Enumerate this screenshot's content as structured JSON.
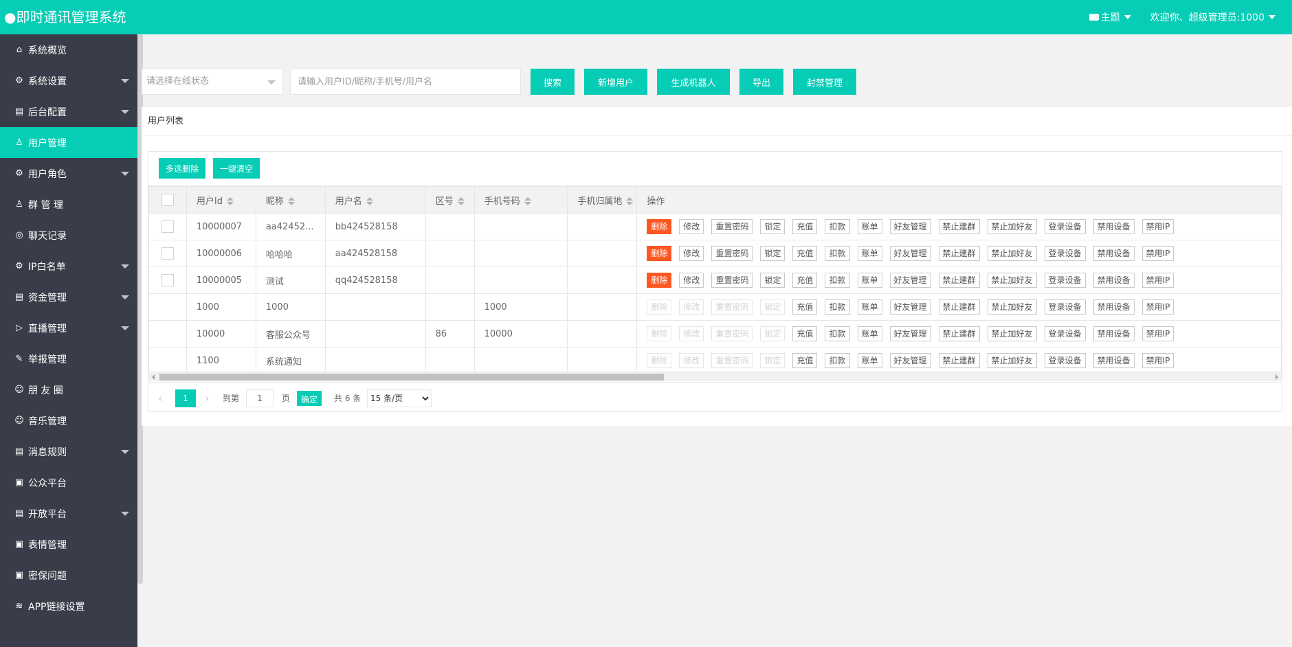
{
  "header": {
    "title": "●即时通讯管理系统",
    "theme_label": "主题",
    "welcome": "欢迎你、超级管理员:1000"
  },
  "sidebar": {
    "items": [
      {
        "label": "系统概览",
        "icon": "home-icon",
        "glyph": "⌂",
        "expandable": false,
        "active": false
      },
      {
        "label": "系统设置",
        "icon": "gear-icon",
        "glyph": "⚙",
        "expandable": true,
        "active": false
      },
      {
        "label": "后台配置",
        "icon": "calendar-icon",
        "glyph": "▤",
        "expandable": true,
        "active": false
      },
      {
        "label": "用户管理",
        "icon": "user-icon",
        "glyph": "♙",
        "expandable": false,
        "active": true
      },
      {
        "label": "用户角色",
        "icon": "gear-icon",
        "glyph": "⚙",
        "expandable": true,
        "active": false
      },
      {
        "label": "群 管 理",
        "icon": "users-icon",
        "glyph": "♙",
        "expandable": false,
        "active": false
      },
      {
        "label": "聊天记录",
        "icon": "chat-icon",
        "glyph": "◎",
        "expandable": false,
        "active": false
      },
      {
        "label": "IP白名单",
        "icon": "gear-icon",
        "glyph": "⚙",
        "expandable": true,
        "active": false
      },
      {
        "label": "资金管理",
        "icon": "calendar-icon",
        "glyph": "▤",
        "expandable": true,
        "active": false
      },
      {
        "label": "直播管理",
        "icon": "play-icon",
        "glyph": "▷",
        "expandable": true,
        "active": false
      },
      {
        "label": "举报管理",
        "icon": "edit-icon",
        "glyph": "✎",
        "expandable": false,
        "active": false
      },
      {
        "label": "朋 友 圈",
        "icon": "smile-icon",
        "glyph": "☺",
        "expandable": false,
        "active": false
      },
      {
        "label": "音乐管理",
        "icon": "smile-icon",
        "glyph": "☺",
        "expandable": false,
        "active": false
      },
      {
        "label": "消息规则",
        "icon": "calendar-icon",
        "glyph": "▤",
        "expandable": true,
        "active": false
      },
      {
        "label": "公众平台",
        "icon": "image-icon",
        "glyph": "▣",
        "expandable": false,
        "active": false
      },
      {
        "label": "开放平台",
        "icon": "calendar-icon",
        "glyph": "▤",
        "expandable": true,
        "active": false
      },
      {
        "label": "表情管理",
        "icon": "image-icon",
        "glyph": "▣",
        "expandable": false,
        "active": false
      },
      {
        "label": "密保问题",
        "icon": "image-icon",
        "glyph": "▣",
        "expandable": false,
        "active": false
      },
      {
        "label": "APP链接设置",
        "icon": "layers-icon",
        "glyph": "≋",
        "expandable": false,
        "active": false
      }
    ]
  },
  "toolbar": {
    "status_placeholder": "请选择在线状态",
    "search_placeholder": "请输入用户ID/昵称/手机号/用户名",
    "buttons": [
      "搜索",
      "新增用户",
      "生成机器人",
      "导出",
      "封禁管理"
    ]
  },
  "panel": {
    "title": "用户列表",
    "bulk_delete": "多选删除",
    "clear_all": "一键清空"
  },
  "table": {
    "columns": [
      "用户Id",
      "昵称",
      "用户名",
      "区号",
      "手机号码",
      "手机归属地",
      "操作"
    ],
    "op_labels": [
      "删除",
      "修改",
      "重置密码",
      "锁定",
      "充值",
      "扣款",
      "账单",
      "好友管理",
      "禁止建群",
      "禁止加好友",
      "登录设备",
      "禁用设备",
      "禁用IP"
    ],
    "rows": [
      {
        "id": "10000007",
        "nickname": "aa42452...",
        "username": "bb424528158",
        "area": "",
        "phone": "",
        "location": "",
        "checkbox": true,
        "admin_ops_enabled": true
      },
      {
        "id": "10000006",
        "nickname": "哈哈哈",
        "username": "aa424528158",
        "area": "",
        "phone": "",
        "location": "",
        "checkbox": true,
        "admin_ops_enabled": true
      },
      {
        "id": "10000005",
        "nickname": "测试",
        "username": "qq424528158",
        "area": "",
        "phone": "",
        "location": "",
        "checkbox": true,
        "admin_ops_enabled": true
      },
      {
        "id": "1000",
        "nickname": "1000",
        "username": "",
        "area": "",
        "phone": "1000",
        "location": "",
        "checkbox": false,
        "admin_ops_enabled": false
      },
      {
        "id": "10000",
        "nickname": "客服公众号",
        "username": "",
        "area": "86",
        "phone": "10000",
        "location": "",
        "checkbox": false,
        "admin_ops_enabled": false
      },
      {
        "id": "1100",
        "nickname": "系统通知",
        "username": "",
        "area": "",
        "phone": "",
        "location": "",
        "checkbox": false,
        "admin_ops_enabled": false
      }
    ]
  },
  "pager": {
    "current_page": "1",
    "goto_label": "到第",
    "goto_value": "1",
    "page_unit": "页",
    "confirm": "确定",
    "total": "共 6 条",
    "page_size": "15 条/页"
  },
  "colors": {
    "accent": "#07ccb6",
    "sidebar_bg": "#393d49",
    "danger": "#ff5722"
  }
}
